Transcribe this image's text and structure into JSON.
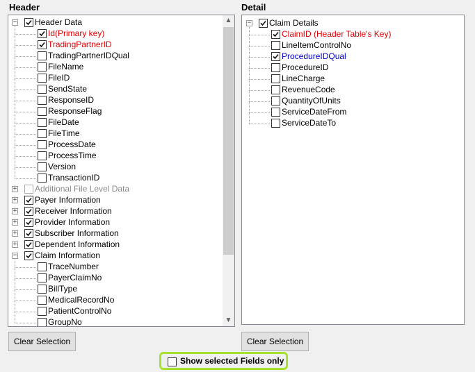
{
  "header_title": "Header",
  "detail_title": "Detail",
  "header_tree": [
    {
      "label": "Header Data",
      "level": 0,
      "expand": "-",
      "checked": true,
      "color": "black"
    },
    {
      "label": "Id(Primary key)",
      "level": 1,
      "checked": true,
      "color": "red"
    },
    {
      "label": "TradingPartnerID",
      "level": 1,
      "checked": true,
      "color": "red"
    },
    {
      "label": "TradingPartnerIDQual",
      "level": 1,
      "checked": false,
      "color": "black"
    },
    {
      "label": "FileName",
      "level": 1,
      "checked": false,
      "color": "black"
    },
    {
      "label": "FileID",
      "level": 1,
      "checked": false,
      "color": "black"
    },
    {
      "label": "SendState",
      "level": 1,
      "checked": false,
      "color": "black"
    },
    {
      "label": "ResponseID",
      "level": 1,
      "checked": false,
      "color": "black"
    },
    {
      "label": "ResponseFlag",
      "level": 1,
      "checked": false,
      "color": "black"
    },
    {
      "label": "FileDate",
      "level": 1,
      "checked": false,
      "color": "black"
    },
    {
      "label": "FileTime",
      "level": 1,
      "checked": false,
      "color": "black"
    },
    {
      "label": "ProcessDate",
      "level": 1,
      "checked": false,
      "color": "black"
    },
    {
      "label": "ProcessTime",
      "level": 1,
      "checked": false,
      "color": "black"
    },
    {
      "label": "Version",
      "level": 1,
      "checked": false,
      "color": "black"
    },
    {
      "label": "TransactionID",
      "level": 1,
      "checked": false,
      "color": "black"
    },
    {
      "label": "Additional File Level Data",
      "level": 0,
      "expand": "+",
      "checked": false,
      "color": "gray",
      "disabled": true
    },
    {
      "label": "Payer Information",
      "level": 0,
      "expand": "+",
      "checked": true,
      "color": "black"
    },
    {
      "label": "Receiver Information",
      "level": 0,
      "expand": "+",
      "checked": true,
      "color": "black"
    },
    {
      "label": "Provider Information",
      "level": 0,
      "expand": "+",
      "checked": true,
      "color": "black"
    },
    {
      "label": "Subscriber Information",
      "level": 0,
      "expand": "+",
      "checked": true,
      "color": "black"
    },
    {
      "label": "Dependent Information",
      "level": 0,
      "expand": "+",
      "checked": true,
      "color": "black"
    },
    {
      "label": "Claim Information",
      "level": 0,
      "expand": "-",
      "checked": true,
      "color": "black"
    },
    {
      "label": "TraceNumber",
      "level": 1,
      "checked": false,
      "color": "black"
    },
    {
      "label": "PayerClaimNo",
      "level": 1,
      "checked": false,
      "color": "black"
    },
    {
      "label": "BillType",
      "level": 1,
      "checked": false,
      "color": "black"
    },
    {
      "label": "MedicalRecordNo",
      "level": 1,
      "checked": false,
      "color": "black"
    },
    {
      "label": "PatientControlNo",
      "level": 1,
      "checked": false,
      "color": "black"
    },
    {
      "label": "GroupNo",
      "level": 1,
      "checked": false,
      "color": "black"
    }
  ],
  "detail_tree": [
    {
      "label": "Claim Details",
      "level": 0,
      "expand": "-",
      "checked": true,
      "color": "black"
    },
    {
      "label": "ClaimID (Header Table's Key)",
      "level": 1,
      "checked": true,
      "color": "red"
    },
    {
      "label": "LineItemControlNo",
      "level": 1,
      "checked": false,
      "color": "black"
    },
    {
      "label": "ProcedureIDQual",
      "level": 1,
      "checked": true,
      "color": "blue"
    },
    {
      "label": "ProcedureID",
      "level": 1,
      "checked": false,
      "color": "black"
    },
    {
      "label": "LineCharge",
      "level": 1,
      "checked": false,
      "color": "black"
    },
    {
      "label": "RevenueCode",
      "level": 1,
      "checked": false,
      "color": "black"
    },
    {
      "label": "QuantityOfUnits",
      "level": 1,
      "checked": false,
      "color": "black"
    },
    {
      "label": "ServiceDateFrom",
      "level": 1,
      "checked": false,
      "color": "black"
    },
    {
      "label": "ServiceDateTo",
      "level": 1,
      "checked": false,
      "color": "black"
    }
  ],
  "clear_selection_label": "Clear Selection",
  "show_selected_label": "Show selected Fields only",
  "show_selected_checked": false,
  "colors": {
    "required": "#e00000",
    "highlight": "#0000c8",
    "disabled": "#8a8a8a",
    "callout": "#a6e22e"
  }
}
